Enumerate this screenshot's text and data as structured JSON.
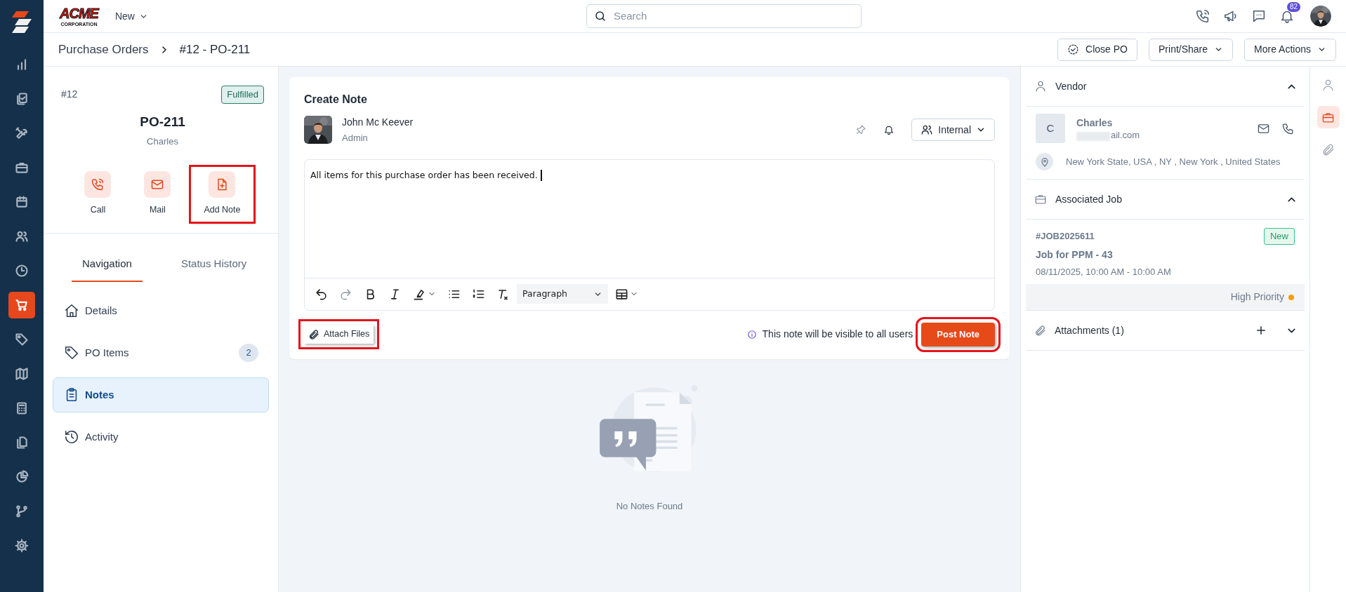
{
  "brand": {
    "name": "ACME",
    "tagline": "CORPORATION"
  },
  "sidebar": {
    "items": [
      {
        "selected": false
      },
      {
        "selected": false
      },
      {
        "selected": false
      },
      {
        "selected": false
      },
      {
        "selected": false
      },
      {
        "selected": false
      },
      {
        "selected": false
      },
      {
        "selected": true
      },
      {
        "selected": false
      },
      {
        "selected": false
      },
      {
        "selected": false
      },
      {
        "selected": false
      },
      {
        "selected": false
      },
      {
        "selected": false
      },
      {
        "selected": false
      }
    ]
  },
  "topbar": {
    "new_menu": "New",
    "search": {
      "placeholder": "Search"
    },
    "notification_count": "82"
  },
  "breadcrumb": [
    "Purchase Orders",
    "#12 - PO-211"
  ],
  "actions": [
    {
      "label": "Close PO",
      "kind": "icon"
    },
    {
      "label": "Print/Share",
      "kind": "dropdown"
    },
    {
      "label": "More Actions",
      "kind": "dropdown"
    }
  ],
  "summary": {
    "number": "#12",
    "status": "Fulfilled",
    "title": "PO-211",
    "vendor": "Charles",
    "quick_actions": [
      {
        "label": "Call",
        "highlighted": false
      },
      {
        "label": "Mail",
        "highlighted": false
      },
      {
        "label": "Add Note",
        "highlighted": true
      }
    ]
  },
  "tabs": [
    {
      "label": "Navigation",
      "selected": true
    },
    {
      "label": "Status History",
      "selected": false
    }
  ],
  "nav": [
    {
      "label": "Details",
      "selected": false
    },
    {
      "label": "PO Items",
      "count": "2",
      "selected": false
    },
    {
      "label": "Notes",
      "selected": true
    },
    {
      "label": "Activity",
      "selected": false
    }
  ],
  "note_editor": {
    "title": "Create Note",
    "author": "John Mc Keever",
    "role": "Admin",
    "visibility": "Internal",
    "text": "All items for this purchase order has been received.",
    "format": "Paragraph",
    "attach": {
      "label": "Attach Files",
      "highlighted": true
    },
    "info": "This note will be visible to all users",
    "post": {
      "label": "Post Note",
      "highlighted": true
    }
  },
  "empty_state": "No Notes Found",
  "vendor": {
    "title": "Vendor",
    "expanded": true,
    "initial": "C",
    "name": "Charles",
    "email": "ail.com",
    "address": "New York State, USA , NY , New York , United States"
  },
  "job": {
    "title": "Associated Job",
    "expanded": true,
    "id": "#JOB2025611",
    "status": "New",
    "name": "Job for PPM - 43",
    "time": "08/11/2025, 10:00 AM - 10:00 AM",
    "priority": {
      "label": "High Priority",
      "color": "#f59e0b"
    }
  },
  "attachments": {
    "title": "Attachments (1)",
    "expanded": false
  },
  "rail": [
    {
      "selected": false
    },
    {
      "selected": true
    },
    {
      "selected": false
    }
  ]
}
